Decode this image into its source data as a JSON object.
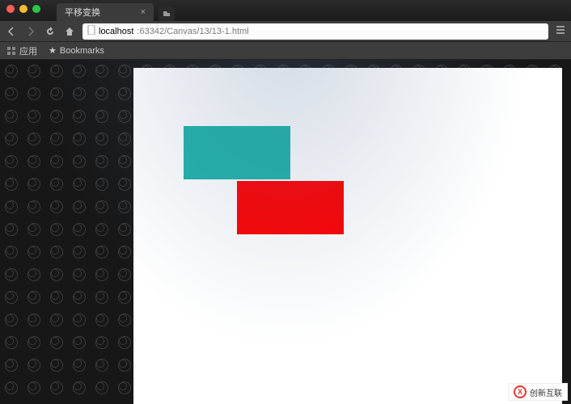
{
  "window": {
    "tab_title": "平移变换"
  },
  "toolbar": {
    "url_host": "localhost",
    "url_rest": ":63342/Canvas/13/13-1.html"
  },
  "bookmarks_bar": {
    "item_apps": "应用",
    "item_bookmarks": "Bookmarks"
  },
  "canvas_demo": {
    "rect1_color": "#20b2aa",
    "rect2_color": "#ff0000"
  },
  "watermark": {
    "text": "创新互联"
  }
}
